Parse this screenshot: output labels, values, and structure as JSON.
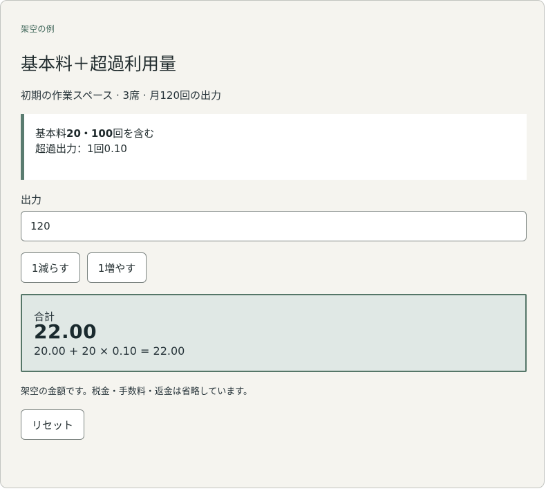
{
  "eyebrow": "架空の例",
  "title": "基本料＋超過利用量",
  "subtitle": "初期の作業スペース · 3席 · 月120回の出力",
  "note": {
    "line1_prefix": "基本料",
    "line1_bold": "20・100",
    "line1_suffix": "回を含む",
    "line2": "超過出力：1回0.10"
  },
  "field": {
    "label": "出力",
    "value": "120"
  },
  "buttons": {
    "decrement": "1減らす",
    "increment": "1増やす",
    "reset": "リセット"
  },
  "result": {
    "label": "合計",
    "value": "22.00",
    "formula": "20.00 + 20 × 0.10 = 22.00"
  },
  "disclaimer": "架空の金額です。税金・手数料・返金は省略しています。",
  "colors": {
    "accent": "#5a7c70",
    "result_bg": "#e0e8e5",
    "card_bg": "#f5f4ef"
  }
}
